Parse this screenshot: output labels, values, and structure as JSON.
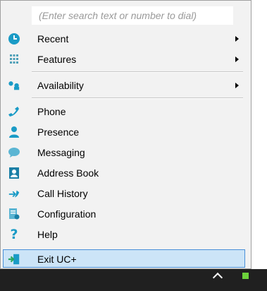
{
  "search": {
    "placeholder": "(Enter search text or number to dial)"
  },
  "menu": {
    "items": [
      {
        "label": "Recent",
        "icon": "clock-icon",
        "submenu": true
      },
      {
        "label": "Features",
        "icon": "grid-icon",
        "submenu": true
      },
      {
        "label": "Availability",
        "icon": "people-icon",
        "submenu": true
      },
      {
        "label": "Phone",
        "icon": "phone-icon"
      },
      {
        "label": "Presence",
        "icon": "person-icon"
      },
      {
        "label": "Messaging",
        "icon": "chat-bubble-icon"
      },
      {
        "label": "Address Book",
        "icon": "address-book-icon"
      },
      {
        "label": "Call History",
        "icon": "call-history-icon"
      },
      {
        "label": "Configuration",
        "icon": "configuration-icon"
      },
      {
        "label": "Help",
        "icon": "question-mark-icon"
      },
      {
        "label": "Exit UC+",
        "icon": "exit-door-icon",
        "highlighted": true
      }
    ]
  },
  "colors": {
    "icon_accent": "#1a9bc6",
    "highlight_bg": "#cce4f7",
    "highlight_border": "#4a90d9"
  }
}
